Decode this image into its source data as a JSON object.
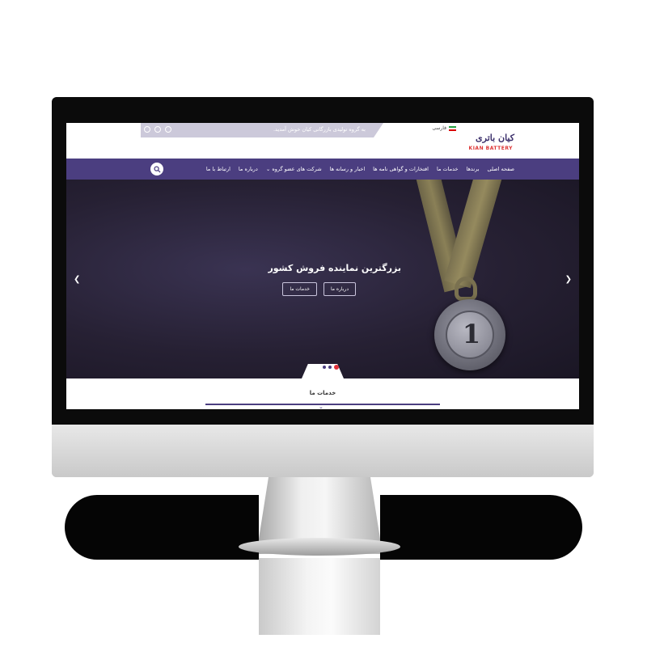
{
  "site": {
    "logo_text": "کیان باتری",
    "logo_en": "KIAN BATTERY",
    "language": "فارسی",
    "welcome": "به گروه تولیدی بازرگانی کیان خوش آمدید."
  },
  "nav": {
    "items": [
      "صفحه اصلی",
      "برندها",
      "خدمات ما",
      "افتخارات و گواهی نامه ها",
      "اخبار و رسانه ها",
      "شرکت های عضو گروه ⌄",
      "درباره ما",
      "ارتباط با ما"
    ]
  },
  "hero": {
    "title": "بزرگترین نماینده فروش کشور",
    "btn_about": "درباره ما",
    "btn_services": "خدمات ما",
    "medal_number": "1"
  },
  "services": {
    "title": "خدمات ما"
  },
  "colors": {
    "brand": "#4b3e80",
    "accent": "#e0303a"
  }
}
